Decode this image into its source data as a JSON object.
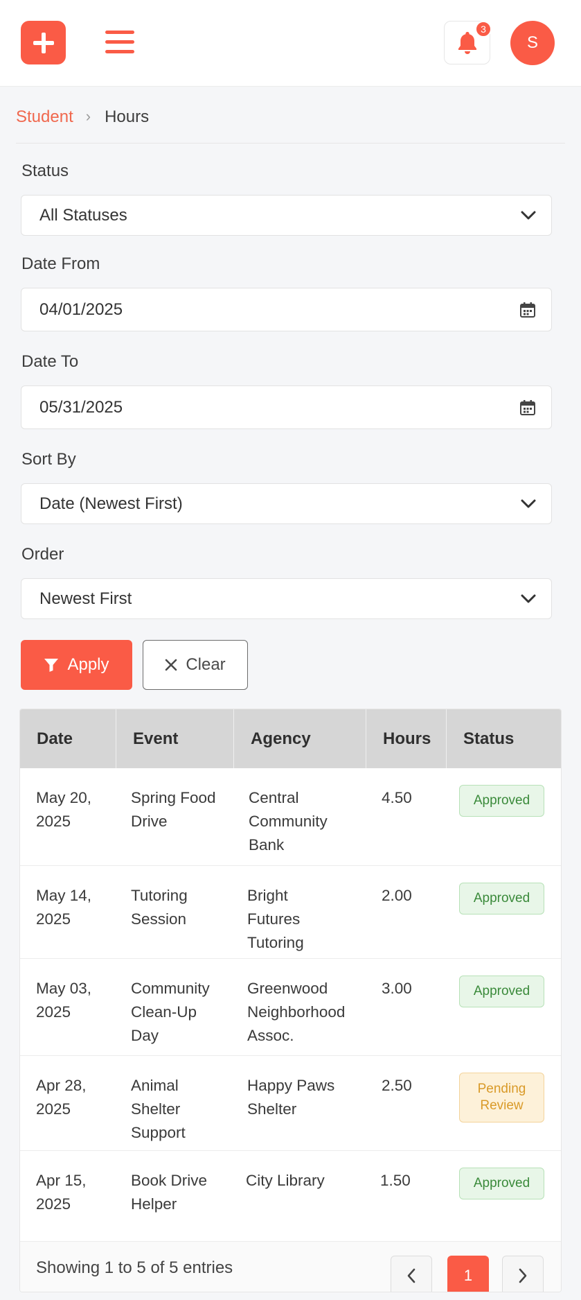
{
  "header": {
    "add_icon": "plus-icon",
    "menu_icon": "hamburger-menu-icon",
    "bell_icon": "bell-icon",
    "notification_count": "3",
    "avatar_initial": "S",
    "accent_color": "#fa5b46"
  },
  "breadcrumb": {
    "parent": "Student",
    "separator": "›",
    "current": "Hours"
  },
  "filters": {
    "status_label": "Status",
    "status_value": "All Statuses",
    "date_from_label": "Date From",
    "date_from_value": "04/01/2025",
    "date_to_label": "Date To",
    "date_to_value": "05/31/2025",
    "sort_by_label": "Sort By",
    "sort_by_value": "Date (Newest First)",
    "order_label": "Order",
    "order_value": "Newest First",
    "apply_label": "Apply",
    "clear_label": "Clear"
  },
  "table": {
    "headers": [
      "Date",
      "Event",
      "Agency",
      "Hours",
      "Status"
    ],
    "rows": [
      {
        "date": "May 20, 2025",
        "event": "Spring Food Drive",
        "agency": "Central Community Bank",
        "hours": "4.50",
        "status": "Approved",
        "status_color": "#3a8a3a"
      },
      {
        "date": "May 14, 2025",
        "event": "Tutoring Session",
        "agency": "Bright Futures Tutoring",
        "hours": "2.00",
        "status": "Approved",
        "status_color": "#3a8a3a"
      },
      {
        "date": "May 03, 2025",
        "event": "Community Clean-Up Day",
        "agency": "Greenwood Neighborhood Assoc.",
        "hours": "3.00",
        "status": "Approved",
        "status_color": "#3a8a3a"
      },
      {
        "date": "Apr 28, 2025",
        "event": "Animal Shelter Support",
        "agency": "Happy Paws Shelter",
        "hours": "2.50",
        "status": "Pending Review",
        "status_color": "#d99a28"
      },
      {
        "date": "Apr 15, 2025",
        "event": "Book Drive Helper",
        "agency": "City Library",
        "hours": "1.50",
        "status": "Approved",
        "status_color": "#3a8a3a"
      }
    ]
  },
  "pagination": {
    "summary": "Showing 1 to 5 of 5 entries",
    "prev_icon": "chevron-left-icon",
    "current_page": "1",
    "next_icon": "chevron-right-icon"
  }
}
